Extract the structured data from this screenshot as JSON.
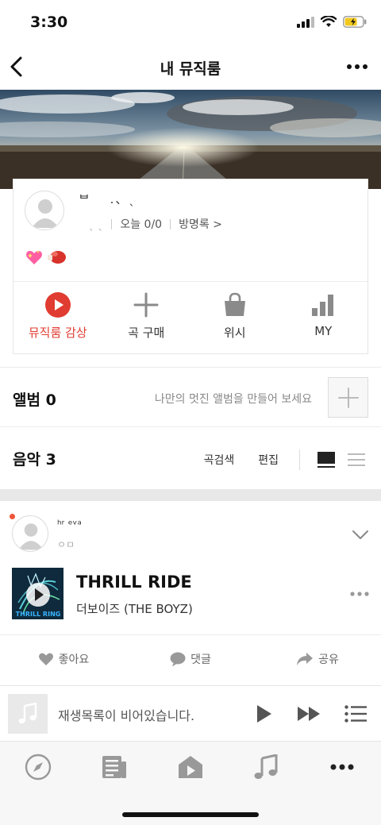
{
  "status": {
    "time": "3:30"
  },
  "nav": {
    "title": "내 뮤직룸",
    "back_icon": "chevron-left-icon",
    "more_icon": "more-horizontal-icon"
  },
  "profile": {
    "name": "ᄇ　 .、ˎ",
    "level": "ㅤˎ ˎ",
    "today_label": "오늘 0/0",
    "guestbook_label": "방명록 >",
    "badges": [
      "sparkling-heart",
      "boxing-glove"
    ]
  },
  "actions": [
    {
      "label": "뮤직룸 감상",
      "icon": "play-circle-icon",
      "color": "#e03c31"
    },
    {
      "label": "곡 구매",
      "icon": "plus-icon"
    },
    {
      "label": "위시",
      "icon": "shopping-bag-icon"
    },
    {
      "label": "MY",
      "icon": "bar-chart-icon"
    }
  ],
  "album": {
    "title": "앨범 0",
    "hint": "나만의 멋진 앨범을 만들어 보세요"
  },
  "music": {
    "title": "음악 3",
    "search_label": "곡검색",
    "edit_label": "편집"
  },
  "feed": {
    "user": "ʰʳ ᵉᵛᵃ",
    "sub": "ㅇㅁ",
    "track_title": "THRILL RIDE",
    "artist": "더보이즈 (THE BOYZ)",
    "album_art_text": "THRILL RING",
    "like_label": "좋아요",
    "comment_label": "댓글",
    "share_label": "공유"
  },
  "player": {
    "empty_text": "재생목록이 비어있습니다."
  },
  "tabs": [
    "compass-icon",
    "news-icon",
    "music-room-icon",
    "music-note-icon",
    "more-icon"
  ],
  "colors": {
    "accent": "#e03c31",
    "icon_gray": "#8a8a8a",
    "band": "#e8e8e8"
  }
}
